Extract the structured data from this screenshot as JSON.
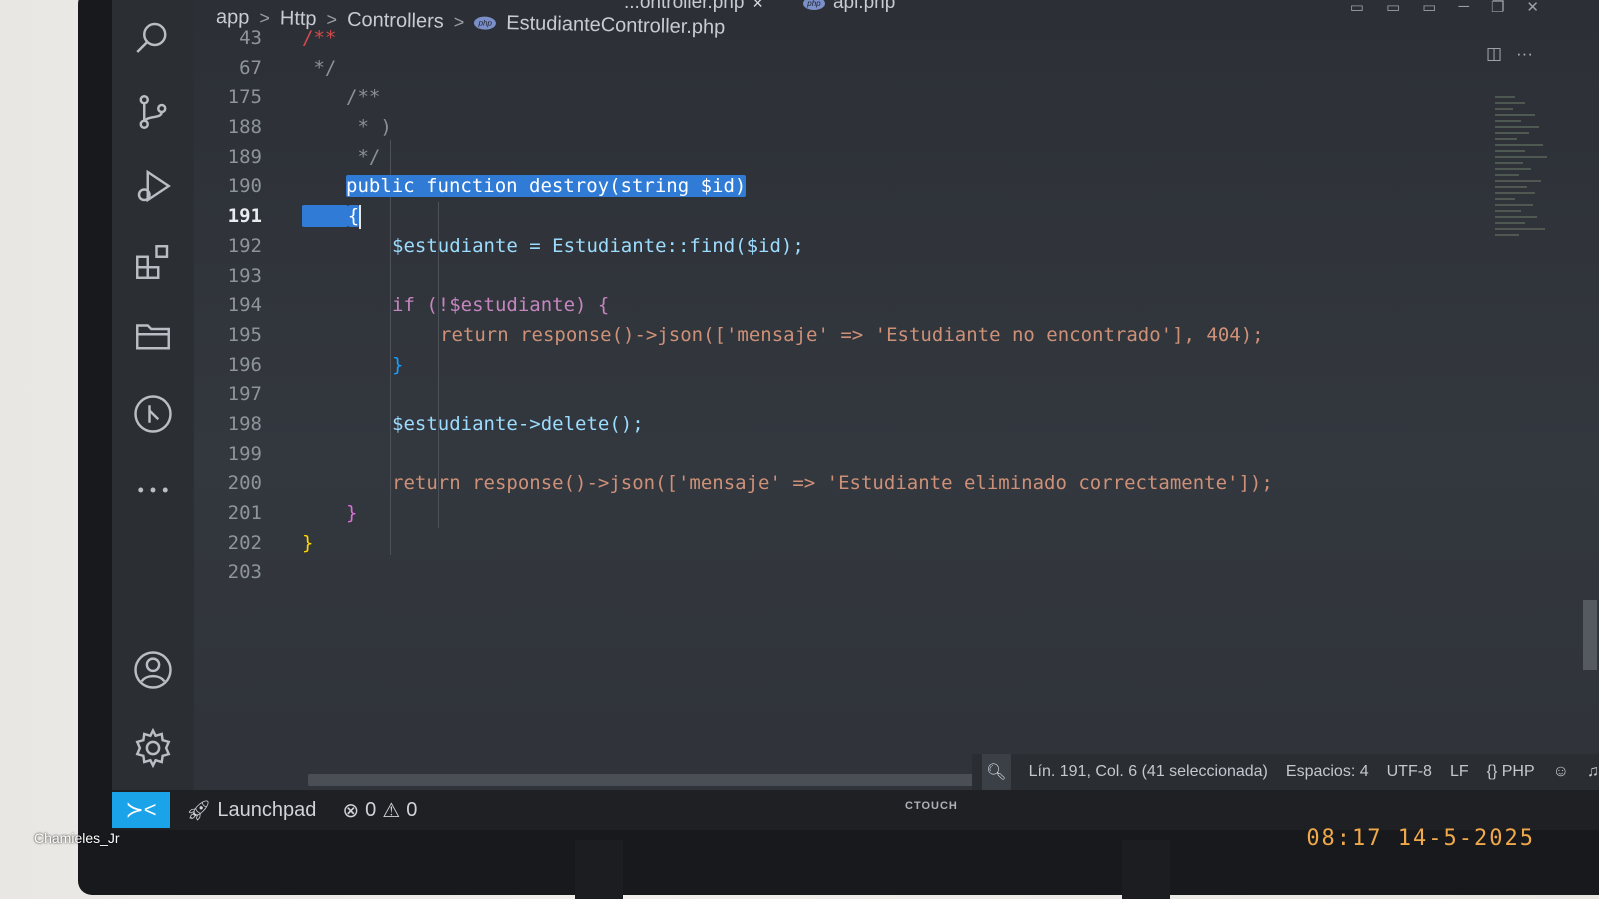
{
  "breadcrumb": {
    "items": [
      "app",
      "Http",
      "Controllers"
    ],
    "file_badge": "php",
    "file": "EstudianteController.php"
  },
  "tabs": [
    {
      "label": "...ontroller.php",
      "close": "×"
    },
    {
      "label": "api.php",
      "badge": "php"
    }
  ],
  "code_lines": [
    {
      "num": "43",
      "text": "/**"
    },
    {
      "num": "67",
      "text": " */"
    },
    {
      "num": "175",
      "text": "/**"
    },
    {
      "num": "188",
      "text": " * )"
    },
    {
      "num": "189",
      "text": " */"
    },
    {
      "num": "190",
      "text": "public function destroy(string $id)"
    },
    {
      "num": "191",
      "text": "{"
    },
    {
      "num": "192",
      "text": "$estudiante = Estudiante::find($id);"
    },
    {
      "num": "193",
      "text": ""
    },
    {
      "num": "194",
      "text": "if (!$estudiante) {"
    },
    {
      "num": "195",
      "text": "return response()->json(['mensaje' => 'Estudiante no encontrado'], 404);"
    },
    {
      "num": "196",
      "text": "}"
    },
    {
      "num": "197",
      "text": ""
    },
    {
      "num": "198",
      "text": "$estudiante->delete();"
    },
    {
      "num": "199",
      "text": ""
    },
    {
      "num": "200",
      "text": "return response()->json(['mensaje' => 'Estudiante eliminado correctamente']);"
    },
    {
      "num": "201",
      "text": "}"
    },
    {
      "num": "202",
      "text": "}"
    },
    {
      "num": "203",
      "text": ""
    }
  ],
  "current_line": "191",
  "status": {
    "position": "Lín. 191, Col. 6 (41 seleccionada)",
    "spaces": "Espacios: 4",
    "encoding": "UTF-8",
    "eol": "LF",
    "language": "PHP",
    "language_icon": "{}",
    "launchpad": "Launchpad",
    "errors": "0",
    "warnings": "0"
  },
  "icons": {
    "activity": [
      "search-icon",
      "source-control-icon",
      "run-debug-icon",
      "extensions-icon",
      "explorer-icon",
      "git-graph-icon",
      "more-icon",
      "account-icon",
      "settings-icon"
    ],
    "remote": "remote-icon"
  },
  "monitor": {
    "brand": "CTOUCH"
  },
  "overlay": {
    "watermark": "Chamieles_Jr",
    "datestamp": "08:17 14-5-2025"
  },
  "colors": {
    "accent": "#1aa3e8",
    "selection": "#2f7bd6"
  }
}
